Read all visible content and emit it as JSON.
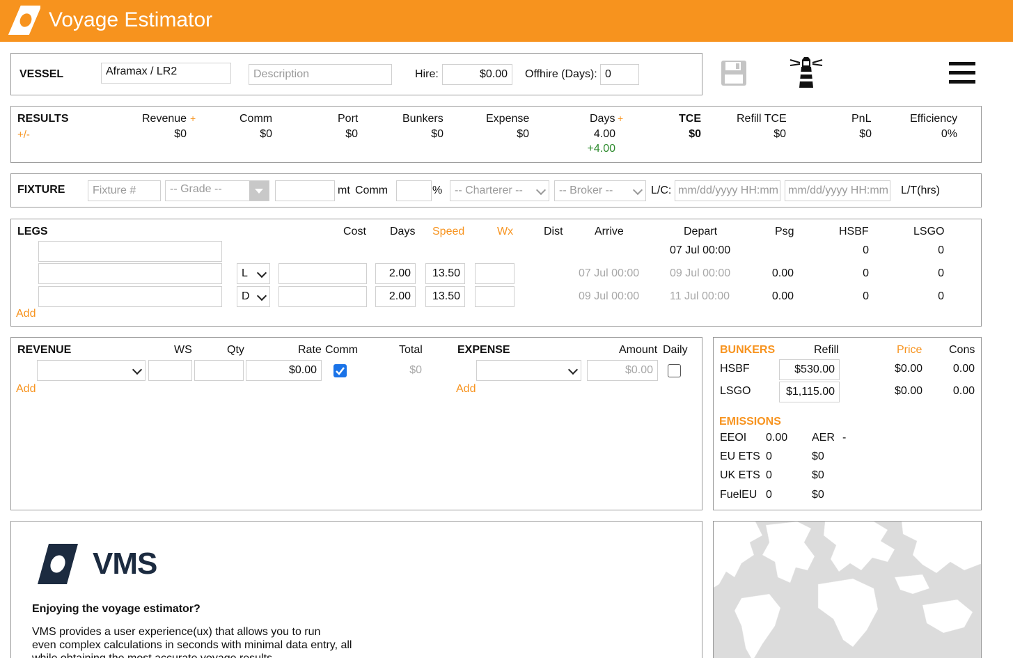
{
  "app": {
    "title": "Voyage Estimator"
  },
  "vessel": {
    "label": "VESSEL",
    "type_value": "Aframax / LR2",
    "description_placeholder": "Description",
    "hire_label": "Hire:",
    "hire_value": "$0.00",
    "offhire_label": "Offhire (Days):",
    "offhire_value": "0"
  },
  "toolbar": {
    "icons": [
      "save-icon",
      "lighthouse-icon",
      "menu-icon"
    ]
  },
  "results": {
    "label": "RESULTS",
    "plusminus": "+/-",
    "plus": "+",
    "cols": [
      {
        "label": "Revenue",
        "value": "$0"
      },
      {
        "label": "Comm",
        "value": "$0"
      },
      {
        "label": "Port",
        "value": "$0"
      },
      {
        "label": "Bunkers",
        "value": "$0"
      },
      {
        "label": "Expense",
        "value": "$0"
      },
      {
        "label": "Days",
        "value": "4.00",
        "delta": "+4.00"
      },
      {
        "label": "TCE",
        "value": "$0"
      },
      {
        "label": "Refill TCE",
        "value": "$0"
      },
      {
        "label": "PnL",
        "value": "$0"
      },
      {
        "label": "Efficiency",
        "value": "0%"
      }
    ]
  },
  "fixture": {
    "label": "FIXTURE",
    "fixture_placeholder": "Fixture #",
    "grade_placeholder": "-- Grade --",
    "mt_label": "mt",
    "comm_label": "Comm",
    "pct_label": "%",
    "charterer_placeholder": "-- Charterer --",
    "broker_placeholder": "-- Broker --",
    "lc_label": "L/C:",
    "date_placeholder_1": "mm/dd/yyyy HH:mm",
    "date_placeholder_2": "mm/dd/yyyy HH:mm",
    "lt_label": "L/T(hrs)"
  },
  "legs": {
    "label": "LEGS",
    "headers": {
      "cost": "Cost",
      "days": "Days",
      "speed": "Speed",
      "wx": "Wx",
      "dist": "Dist",
      "arrive": "Arrive",
      "depart": "Depart",
      "psg": "Psg",
      "hsbf": "HSBF",
      "lsgo": "LSGO"
    },
    "first_row": {
      "depart": "07 Jul 00:00",
      "hsbf": "0",
      "lsgo": "0"
    },
    "rows": [
      {
        "type": "L",
        "days": "2.00",
        "speed": "13.50",
        "arrive": "07 Jul 00:00",
        "depart": "09 Jul 00:00",
        "psg": "0.00",
        "hsbf": "0",
        "lsgo": "0"
      },
      {
        "type": "D",
        "days": "2.00",
        "speed": "13.50",
        "arrive": "09 Jul 00:00",
        "depart": "11 Jul 00:00",
        "psg": "0.00",
        "hsbf": "0",
        "lsgo": "0"
      }
    ],
    "add_label": "Add"
  },
  "revenue": {
    "label": "REVENUE",
    "headers": {
      "ws": "WS",
      "qty": "Qty",
      "rate": "Rate",
      "comm": "Comm",
      "total": "Total"
    },
    "row": {
      "rate": "$0.00",
      "comm_checked": true,
      "total": "$0"
    },
    "add_label": "Add"
  },
  "expense": {
    "label": "EXPENSE",
    "headers": {
      "amount": "Amount",
      "daily": "Daily"
    },
    "row": {
      "amount": "$0.00",
      "daily_checked": false
    },
    "add_label": "Add"
  },
  "bunkers": {
    "label": "BUNKERS",
    "headers": {
      "refill": "Refill",
      "price": "Price",
      "cons": "Cons"
    },
    "rows": [
      {
        "name": "HSBF",
        "refill": "$530.00",
        "price": "$0.00",
        "cons": "0.00"
      },
      {
        "name": "LSGO",
        "refill": "$1,115.00",
        "price": "$0.00",
        "cons": "0.00"
      }
    ]
  },
  "emissions": {
    "label": "EMISSIONS",
    "rows": [
      {
        "name": "EEOI",
        "v1": "0.00",
        "name2": "AER",
        "v2": "-"
      },
      {
        "name": "EU ETS",
        "v1": "0",
        "v2": "$0"
      },
      {
        "name": "UK ETS",
        "v1": "0",
        "v2": "$0"
      },
      {
        "name": "FuelEU",
        "v1": "0",
        "v2": "$0"
      }
    ]
  },
  "promo": {
    "brand": "VMS",
    "heading": "Enjoying the voyage estimator?",
    "body_line1": "VMS provides a user experience(ux) that allows you to run",
    "body_line2": "even complex calculations in seconds with minimal data entry, all",
    "body_line3": "while obtaining the most accurate voyage results."
  },
  "colors": {
    "brand_orange": "#f7931e",
    "positive_green": "#2e8b2e",
    "checkbox_blue": "#1a73e8",
    "map_bg": "#dcdcdc"
  }
}
